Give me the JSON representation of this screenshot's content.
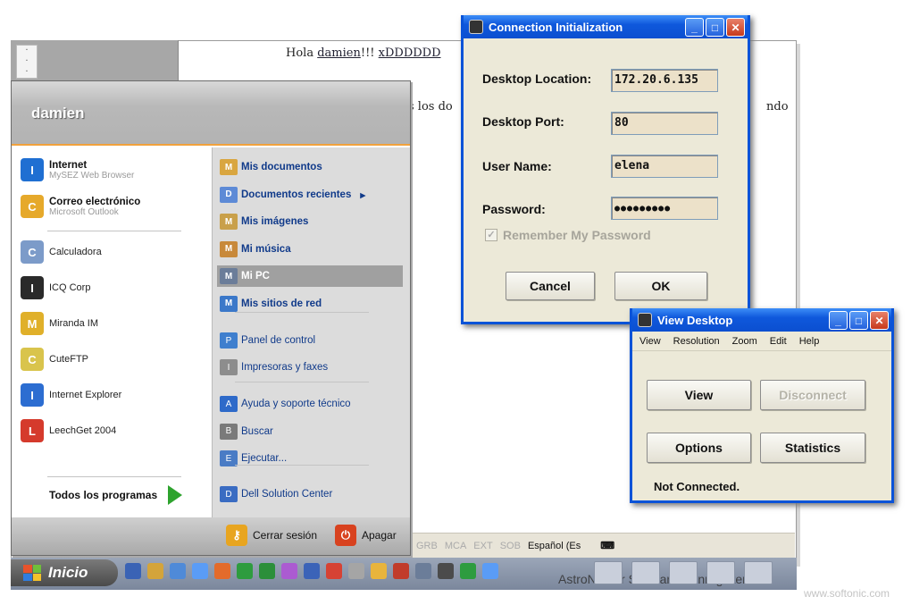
{
  "background_doc": {
    "greeting_prefix": "Hola ",
    "greeting_name": "damien",
    "greeting_mid": "!!! ",
    "greeting_smiley": "xDDDDDD",
    "fragment_left": "s los do",
    "fragment_right": "ndo"
  },
  "start_menu": {
    "user_name": "damien",
    "pinned": [
      {
        "title": "Internet",
        "subtitle": "MySEZ Web Browser",
        "icon": "ie-globe-icon",
        "color": "#1f6fd2"
      },
      {
        "title": "Correo electrónico",
        "subtitle": "Microsoft Outlook",
        "icon": "outlook-icon",
        "color": "#e6a92b"
      }
    ],
    "recent": [
      {
        "label": "Calculadora",
        "icon": "calculator-icon",
        "color": "#7c9bc9"
      },
      {
        "label": "ICQ Corp",
        "icon": "icq-flower-icon",
        "color": "#2a2a2a"
      },
      {
        "label": "Miranda IM",
        "icon": "miranda-icon",
        "color": "#e0b02a"
      },
      {
        "label": "CuteFTP",
        "icon": "cuteftp-icon",
        "color": "#d9c44c"
      },
      {
        "label": "Internet Explorer",
        "icon": "ie-e-icon",
        "color": "#2c6dd1"
      },
      {
        "label": "LeechGet 2004",
        "icon": "leechget-icon",
        "color": "#d53a2c"
      }
    ],
    "all_programs": "Todos los programas",
    "places": [
      {
        "label": "Mis documentos",
        "bold": true,
        "icon": "my-documents-icon",
        "color": "#d9a640"
      },
      {
        "label": "Documentos recientes",
        "bold": true,
        "icon": "recent-documents-icon",
        "color": "#5d8ad6",
        "arrow": "▸"
      },
      {
        "label": "Mis imágenes",
        "bold": true,
        "icon": "my-pictures-icon",
        "color": "#c9a04a"
      },
      {
        "label": "Mi música",
        "bold": true,
        "icon": "my-music-icon",
        "color": "#c8893a"
      },
      {
        "label": "Mi PC",
        "bold": true,
        "icon": "my-computer-icon",
        "color": "#6b7d99",
        "selected": true
      },
      {
        "label": "Mis sitios de red",
        "bold": true,
        "icon": "network-places-icon",
        "color": "#3b78c9"
      }
    ],
    "system": [
      {
        "label": "Panel de control",
        "icon": "control-panel-icon",
        "color": "#3f7fce"
      },
      {
        "label": "Impresoras y faxes",
        "icon": "printer-icon",
        "color": "#8d8d8d"
      }
    ],
    "help": [
      {
        "label": "Ayuda y soporte técnico",
        "icon": "help-icon",
        "color": "#2e6ac9"
      },
      {
        "label": "Buscar",
        "icon": "search-icon",
        "color": "#7a7a7a"
      },
      {
        "label": "Ejecutar...",
        "icon": "run-icon",
        "color": "#4a7cc5"
      }
    ],
    "extra": [
      {
        "label": "Dell Solution Center",
        "icon": "dell-icon",
        "color": "#3a6cc2"
      }
    ],
    "logoff": "Cerrar sesión",
    "shutdown": "Apagar"
  },
  "taskbar": {
    "start_label": "Inicio",
    "status_items": [
      "GRB",
      "MCA",
      "EXT",
      "SOB"
    ],
    "language": "Español (Es",
    "app_title": "AstroNomer Software - Unregistered",
    "tray_colors": [
      "#3a63b5",
      "#d4a43a",
      "#4f8ad8",
      "#5a9cf6",
      "#e36b2b",
      "#2e9c3f",
      "#2b8f3a",
      "#ab5bd1",
      "#3b63b8",
      "#d64234",
      "#a5a5a5",
      "#e8b43c",
      "#c13c2b",
      "#6b7d99",
      "#4b4b4b",
      "#2e9c3f",
      "#5a9cf6"
    ]
  },
  "watermark": "www.softonic.com",
  "connection_dialog": {
    "title": "Connection Initialization",
    "fields": [
      {
        "label": "Desktop Location:",
        "value": "172.20.6.135"
      },
      {
        "label": "Desktop Port:",
        "value": "80"
      },
      {
        "label": "User Name:",
        "value": "elena"
      },
      {
        "label": "Password:",
        "value": "●●●●●●●●●"
      }
    ],
    "remember": "Remember My Password",
    "cancel": "Cancel",
    "ok": "OK"
  },
  "view_dialog": {
    "title": "View Desktop",
    "menu": [
      "View",
      "Resolution",
      "Zoom",
      "Edit",
      "Help"
    ],
    "view": "View",
    "disconnect": "Disconnect",
    "options": "Options",
    "statistics": "Statistics",
    "status": "Not Connected."
  }
}
